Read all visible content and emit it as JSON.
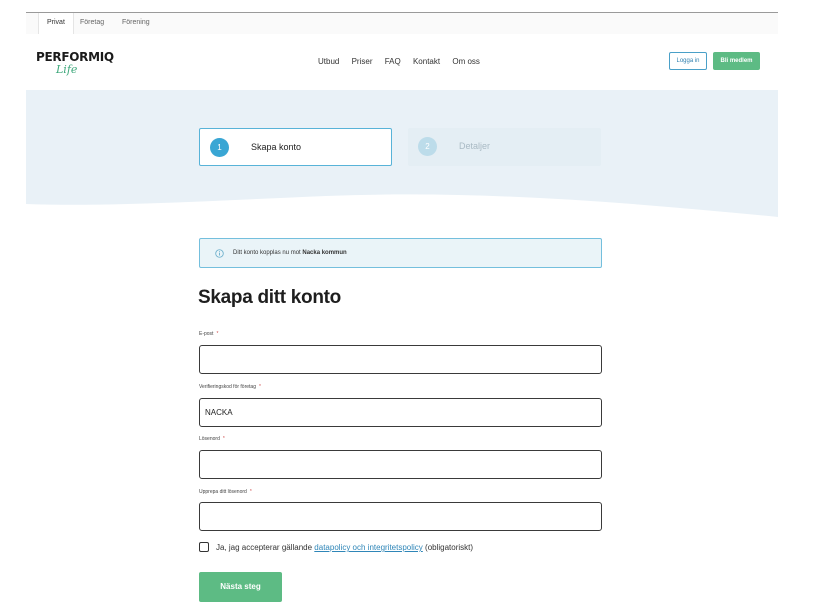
{
  "segments": [
    "Privat",
    "Företag",
    "Förening"
  ],
  "logo": {
    "main": "PERFORMIQ",
    "sub": "Life"
  },
  "nav": [
    "Utbud",
    "Priser",
    "FAQ",
    "Kontakt",
    "Om oss"
  ],
  "header_buttons": {
    "login": "Logga in",
    "member": "Bli medlem"
  },
  "steps": [
    {
      "number": "1",
      "label": "Skapa konto"
    },
    {
      "number": "2",
      "label": "Detaljer"
    }
  ],
  "info": {
    "text_prefix": "Ditt konto kopplas nu mot ",
    "text_strong": "Nacka kommun"
  },
  "form": {
    "title": "Skapa ditt konto",
    "required_mark": "*",
    "fields": [
      {
        "label": "E-post",
        "value": ""
      },
      {
        "label": "Verifieringskod för företag",
        "value": "NACKA"
      },
      {
        "label": "Lösenord",
        "value": ""
      },
      {
        "label": "Upprepa ditt lösenord",
        "value": ""
      }
    ],
    "consent": {
      "prefix": "Ja, jag accepterar gällande ",
      "link": "datapolicy och integritetspolicy",
      "suffix": " (obligatoriskt)"
    },
    "submit": "Nästa steg"
  },
  "colors": {
    "accent_green": "#5dbb84",
    "accent_blue": "#39a6d4",
    "hero_bg": "#e9f1f7"
  }
}
